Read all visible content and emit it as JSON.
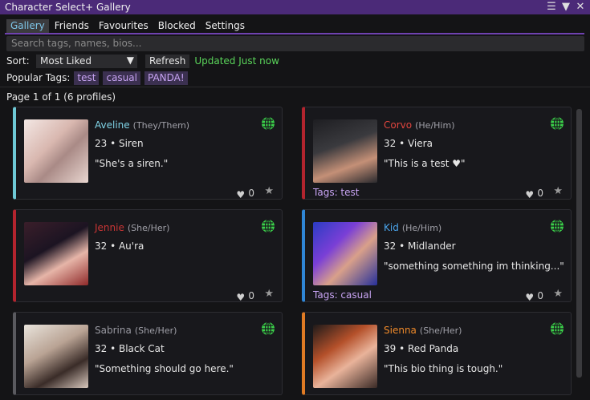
{
  "window": {
    "title": "Character Select+ Gallery"
  },
  "tabs": [
    "Gallery",
    "Friends",
    "Favourites",
    "Blocked",
    "Settings"
  ],
  "search": {
    "placeholder": "Search tags, names, bios..."
  },
  "sort": {
    "label": "Sort:",
    "value": "Most Liked",
    "refresh_label": "Refresh",
    "updated_text": "Updated Just now"
  },
  "popular_tags": {
    "label": "Popular Tags:",
    "tags": [
      "test",
      "casual",
      "PANDA!"
    ]
  },
  "page_info": "Page 1 of 1 (6 profiles)",
  "profiles": [
    {
      "name": "Aveline",
      "pronouns": "(They/Them)",
      "info": "23 • Siren",
      "bio": "\"She's a siren.\"",
      "likes": "0",
      "tags_line": "",
      "accent": "#6ec9d6",
      "name_color": "#7fd3e6"
    },
    {
      "name": "Corvo",
      "pronouns": "(He/Him)",
      "info": "32 • Viera",
      "bio": "\"This is a test ♥\"",
      "likes": "0",
      "tags_line": "Tags: test",
      "accent": "#b3242e",
      "name_color": "#e0453e"
    },
    {
      "name": "Jennie",
      "pronouns": "(She/Her)",
      "info": "32 • Au'ra",
      "bio": "",
      "likes": "0",
      "tags_line": "",
      "accent": "#b3242e",
      "name_color": "#c93535"
    },
    {
      "name": "Kid",
      "pronouns": "(He/Him)",
      "info": "32 • Midlander",
      "bio": "\"something something im thinking...\"",
      "likes": "0",
      "tags_line": "Tags: casual",
      "accent": "#2f86d6",
      "name_color": "#4aa3ea"
    },
    {
      "name": "Sabrina",
      "pronouns": "(She/Her)",
      "info": "32 • Black Cat",
      "bio": "\"Something should go here.\"",
      "likes": "",
      "tags_line": "",
      "accent": "#5a5a5f",
      "name_color": "#9a9aa2"
    },
    {
      "name": "Sienna",
      "pronouns": "(She/Her)",
      "info": "39 • Red Panda",
      "bio": "\"This bio thing is tough.\"",
      "likes": "",
      "tags_line": "",
      "accent": "#e07b24",
      "name_color": "#f08a2a"
    }
  ],
  "icons": {
    "menu": "hamburger-icon",
    "collapse": "triangle-down-icon",
    "close": "close-icon",
    "globe": "globe-icon",
    "heart": "heart-icon",
    "star": "star-icon"
  }
}
